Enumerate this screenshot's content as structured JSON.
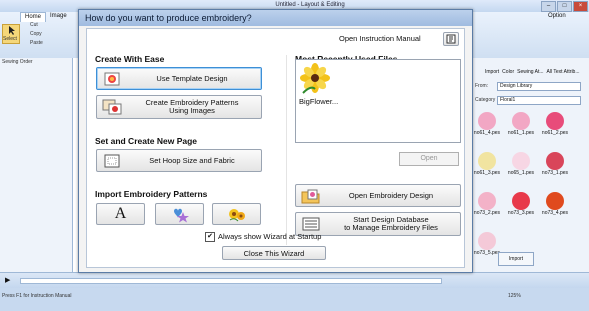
{
  "app": {
    "title": "Untitled - Layout & Editing",
    "tabs": [
      "Home",
      "Image"
    ],
    "option_tab": "Option",
    "select_label": "Select",
    "clipboard_items": [
      "Cut",
      "Copy",
      "Paste"
    ],
    "left_panel_title": "Sewing Order",
    "right_panel_tabs": [
      "Import",
      "Color",
      "Sewing At...",
      "All Text Attrib..."
    ],
    "right_panel_from_label": "From:",
    "right_panel_from_value": "Design Library",
    "right_panel_category_label": "Category",
    "right_panel_category_value": "Floral1",
    "thumbnails": [
      "no61_4.pes",
      "no61_1.pes",
      "no61_2.pes",
      "no61_3.pes",
      "no65_1.pes",
      "no73_1.pes",
      "no73_2.pes",
      "no73_3.pes",
      "no73_4.pes",
      "no73_5.pes"
    ],
    "import_button": "Import",
    "status_text": "Press F1 for Instruction Manual",
    "zoom": "125%",
    "thumb_colors": [
      "#f2a7c4",
      "#f2a7c4",
      "#e84c7a",
      "#f1e4a0",
      "#f7d6e4",
      "#d9455a",
      "#f3b2c8",
      "#e8394b",
      "#e04a1e",
      "#f4c9d8"
    ]
  },
  "dialog": {
    "title": "How do you want to produce embroidery?",
    "open_manual_label": "Open Instruction Manual",
    "create_section": "Create With Ease",
    "use_template_button": "Use Template Design",
    "create_from_images_line1": "Create Embroidery Patterns",
    "create_from_images_line2": "Using Images",
    "new_page_section": "Set and Create New Page",
    "hoop_button": "Set Hoop Size and Fabric",
    "import_section": "Import Embroidery Patterns",
    "import_text_glyph": "A",
    "mru_section": "Most Recently Used Files",
    "mru_file": "BigFlower...",
    "open_button": "Open",
    "open_design_button": "Open Embroidery Design",
    "database_line1": "Start Design Database",
    "database_line2": "to Manage Embroidery Files",
    "always_show_label": "Always show Wizard at Startup",
    "always_show_checked": true,
    "close_button": "Close This Wizard"
  }
}
